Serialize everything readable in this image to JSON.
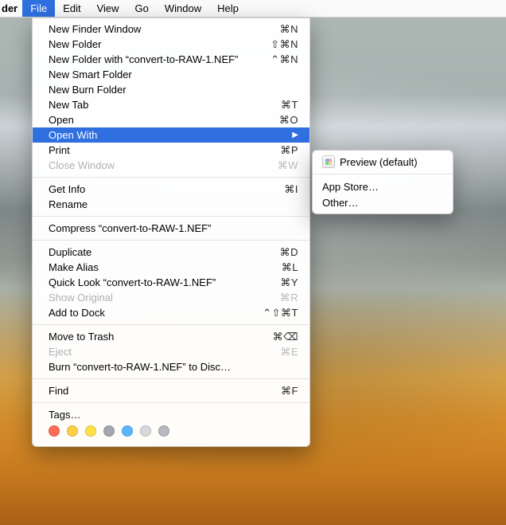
{
  "menubar": {
    "app_name_fragment": "der",
    "items": [
      {
        "label": "File",
        "active": true
      },
      {
        "label": "Edit",
        "active": false
      },
      {
        "label": "View",
        "active": false
      },
      {
        "label": "Go",
        "active": false
      },
      {
        "label": "Window",
        "active": false
      },
      {
        "label": "Help",
        "active": false
      }
    ]
  },
  "file_menu": {
    "groups": [
      [
        {
          "label": "New Finder Window",
          "shortcut": "⌘N",
          "disabled": false
        },
        {
          "label": "New Folder",
          "shortcut": "⇧⌘N",
          "disabled": false
        },
        {
          "label": "New Folder with “convert-to-RAW-1.NEF”",
          "shortcut": "⌃⌘N",
          "disabled": false
        },
        {
          "label": "New Smart Folder",
          "shortcut": "",
          "disabled": false
        },
        {
          "label": "New Burn Folder",
          "shortcut": "",
          "disabled": false
        },
        {
          "label": "New Tab",
          "shortcut": "⌘T",
          "disabled": false
        },
        {
          "label": "Open",
          "shortcut": "⌘O",
          "disabled": false
        },
        {
          "label": "Open With",
          "shortcut": "",
          "disabled": false,
          "selected": true,
          "submenu": true
        },
        {
          "label": "Print",
          "shortcut": "⌘P",
          "disabled": false
        },
        {
          "label": "Close Window",
          "shortcut": "⌘W",
          "disabled": true
        }
      ],
      [
        {
          "label": "Get Info",
          "shortcut": "⌘I",
          "disabled": false
        },
        {
          "label": "Rename",
          "shortcut": "",
          "disabled": false
        }
      ],
      [
        {
          "label": "Compress “convert-to-RAW-1.NEF”",
          "shortcut": "",
          "disabled": false
        }
      ],
      [
        {
          "label": "Duplicate",
          "shortcut": "⌘D",
          "disabled": false
        },
        {
          "label": "Make Alias",
          "shortcut": "⌘L",
          "disabled": false
        },
        {
          "label": "Quick Look “convert-to-RAW-1.NEF”",
          "shortcut": "⌘Y",
          "disabled": false
        },
        {
          "label": "Show Original",
          "shortcut": "⌘R",
          "disabled": true
        },
        {
          "label": "Add to Dock",
          "shortcut": "⌃⇧⌘T",
          "disabled": false
        }
      ],
      [
        {
          "label": "Move to Trash",
          "shortcut": "⌘⌫",
          "disabled": false
        },
        {
          "label": "Eject",
          "shortcut": "⌘E",
          "disabled": true
        },
        {
          "label": "Burn “convert-to-RAW-1.NEF” to Disc…",
          "shortcut": "",
          "disabled": false
        }
      ],
      [
        {
          "label": "Find",
          "shortcut": "⌘F",
          "disabled": false
        }
      ],
      [
        {
          "label": "Tags…",
          "shortcut": "",
          "disabled": false
        }
      ]
    ],
    "tag_colors": [
      "#ff6b57",
      "#ffcf4a",
      "#ffe14a",
      "#a4a7ad",
      "#5ab7ff",
      "#d9d9dd",
      "#b7b9bf"
    ]
  },
  "open_with_submenu": {
    "default_label": "Preview (default)",
    "items": [
      "App Store…",
      "Other…"
    ]
  }
}
